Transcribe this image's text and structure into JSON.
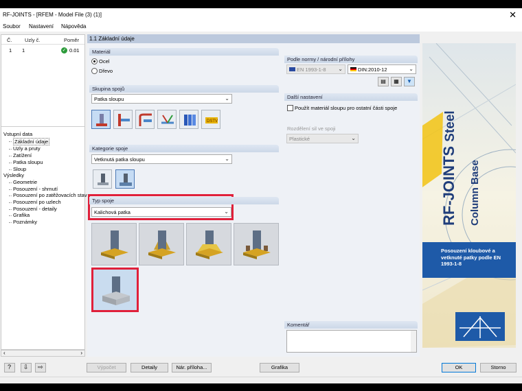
{
  "window": {
    "title": "RF-JOINTS - [RFEM - Model File (3) (1)]"
  },
  "menu": [
    "Soubor",
    "Nastavení",
    "Nápověda"
  ],
  "left_table": {
    "headers": [
      "Č.",
      "Uzly č.",
      "Poměr"
    ],
    "row": {
      "no": "1",
      "nodes": "1",
      "ratio": "0.01"
    }
  },
  "tree": {
    "input_group": "Vstupní data",
    "input_items": [
      "Základní údaje",
      "Uzly a pruty",
      "Zatížení",
      "Patka sloupu",
      "Sloup"
    ],
    "results_group": "Výsledky",
    "results_items": [
      "Geometrie",
      "Posouzení - shrnutí",
      "Posouzení po zatěžovacích stavech",
      "Posouzení po uzlech",
      "Posouzení - detaily",
      "Grafika",
      "Poznámky"
    ]
  },
  "main": {
    "header": "1.1 Základní údaje",
    "material": {
      "title": "Materiál",
      "options": [
        "Ocel",
        "Dřevo"
      ],
      "selected": 0
    },
    "joint_group": {
      "title": "Skupina spojů",
      "value": "Patka sloupu"
    },
    "joint_category": {
      "title": "Kategorie spoje",
      "value": "Vetknutá patka sloupu"
    },
    "joint_type": {
      "title": "Typ spoje",
      "value": "Kalichová patka"
    },
    "norm": {
      "title": "Podle normy / národní přílohy",
      "standard": "EN 1993-1-8",
      "annex": "DIN:2010-12"
    },
    "other": {
      "title": "Další nastavení",
      "checkbox": "Použít materiál sloupu pro ostatní části spoje",
      "distribution_label": "Rozdělení sil ve spoji",
      "distribution_value": "Plastické"
    },
    "comment": {
      "title": "Komentář",
      "value": ""
    }
  },
  "banner": {
    "title1": "RF-JOINTS",
    "title2": "Steel",
    "subtitle": "Column Base",
    "description": "Posouzení kloubové a vetknuté patky podle EN 1993-1-8",
    "colors": {
      "title": "#1f3d7a",
      "accent": "#f2c313",
      "logo_bg": "#1e5aa8"
    }
  },
  "buttons": {
    "calc": "Výpočet",
    "details": "Detaily",
    "annex": "Nár. příloha...",
    "graphics": "Grafika",
    "ok": "OK",
    "cancel": "Storno"
  },
  "colors": {
    "selection_box": "#e0203a",
    "check": "#2c9b3a"
  }
}
